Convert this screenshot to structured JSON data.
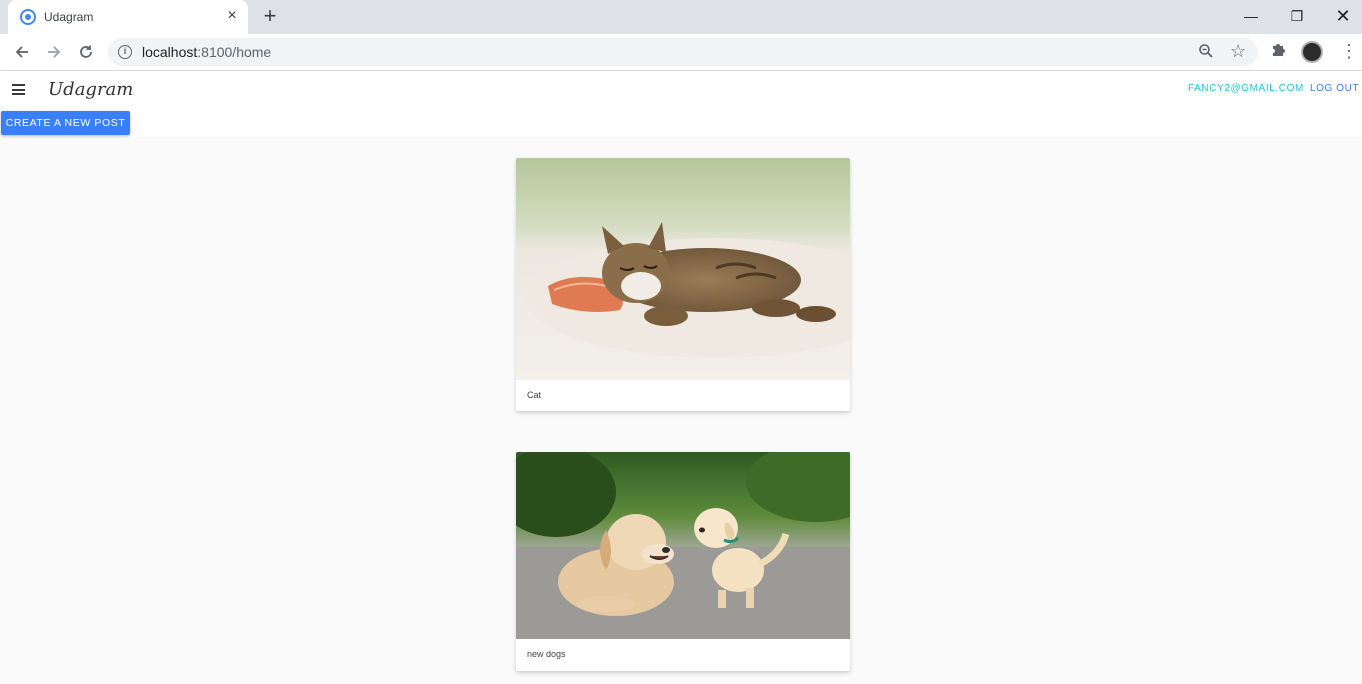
{
  "browser": {
    "tab_title": "Udagram",
    "url_host": "localhost",
    "url_path": ":8100/home"
  },
  "header": {
    "brand": "Udagram",
    "user_email": "FANCY2@GMAIL.COM",
    "logout_label": "LOG OUT"
  },
  "actions": {
    "create_post_label": "CREATE A NEW POST"
  },
  "feed": {
    "items": [
      {
        "caption": "Cat",
        "image": "sleeping-kitten-on-blanket"
      },
      {
        "caption": "new dogs",
        "image": "labrador-and-puppy-on-road"
      }
    ]
  },
  "colors": {
    "primary": "#3880ff",
    "email_accent": "#1ec8dc",
    "page_background": "#fafafa"
  },
  "icons": {
    "menu": "hamburger-icon",
    "info": "info-icon",
    "zoom": "zoom-icon",
    "bookmark": "star-icon",
    "extensions": "puzzle-icon"
  }
}
